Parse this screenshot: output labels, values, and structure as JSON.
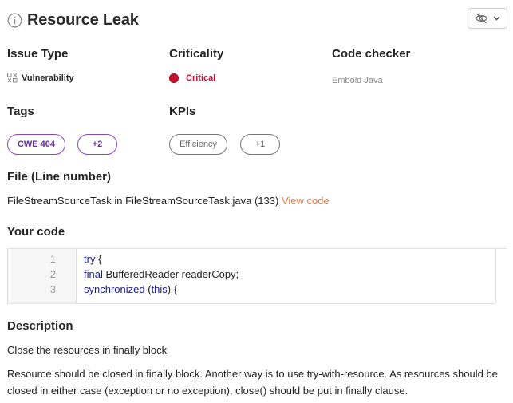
{
  "header": {
    "title": "Resource Leak",
    "info_icon": "info-circle-icon"
  },
  "visibility_dropdown": {
    "icon": "eye-off-icon",
    "chevron": "chevron-down-icon"
  },
  "issue_type": {
    "label": "Issue Type",
    "value": "Vulnerability",
    "icon": "vulnerability-icon"
  },
  "criticality": {
    "label": "Criticality",
    "value": "Critical",
    "color": "#c8102e"
  },
  "code_checker": {
    "label": "Code checker",
    "value": "Embold Java"
  },
  "tags": {
    "label": "Tags",
    "items": [
      "CWE 404",
      "+2"
    ],
    "color": "#8e44c9"
  },
  "kpis": {
    "label": "KPIs",
    "items": [
      "Efficiency",
      "+1"
    ]
  },
  "file": {
    "label": "File (Line number)",
    "text": "FileStreamSourceTask in FileStreamSourceTask.java (133)",
    "link": "View code",
    "link_color": "#e8793e"
  },
  "your_code": {
    "label": "Your code",
    "line_numbers": [
      "1",
      "2",
      "3"
    ],
    "lines": [
      {
        "keyword": "try",
        "rest": " {"
      },
      {
        "keyword": "final",
        "rest": " BufferedReader readerCopy;"
      },
      {
        "keyword": "synchronized",
        "rest": " (",
        "keyword2": "this",
        "rest2": ") {"
      }
    ]
  },
  "description": {
    "label": "Description",
    "short": "Close the resources in finally block",
    "long": "Resource should be closed in finally block. Another way is to use try-with-resource. As resources should be closed in either case (exception or no exception), close() should be put in finally clause."
  }
}
